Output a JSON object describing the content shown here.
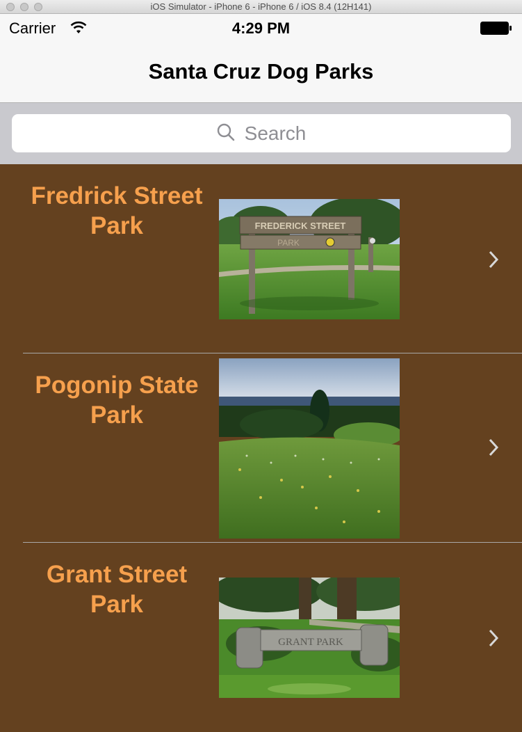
{
  "window": {
    "title": "iOS Simulator - iPhone 6 - iPhone 6 / iOS 8.4 (12H141)"
  },
  "status_bar": {
    "carrier": "Carrier",
    "time": "4:29 PM"
  },
  "nav": {
    "title": "Santa Cruz Dog Parks"
  },
  "search": {
    "placeholder": "Search"
  },
  "parks": [
    {
      "name": "Fredrick Street Park",
      "sign_text": "FREDERICK STREET PARK"
    },
    {
      "name": "Pogonip State Park"
    },
    {
      "name": "Grant Street Park",
      "sign_text": "GRANT PARK"
    }
  ],
  "colors": {
    "background": "#64411f",
    "row_title": "#f6a04d"
  }
}
